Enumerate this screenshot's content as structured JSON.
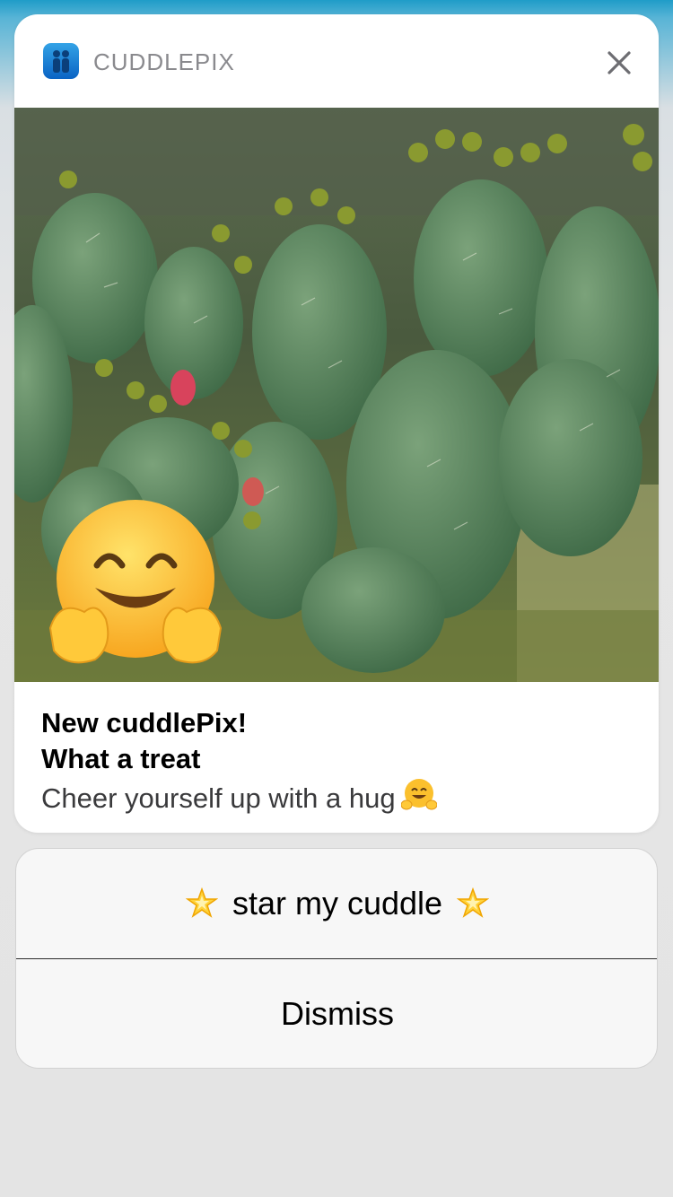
{
  "notification": {
    "app_name": "CUDDLEPIX",
    "app_icon": "cuddlepix-app-icon",
    "close_icon": "close-icon",
    "image": "cactus-photo-with-hug-emoji",
    "title_line_1": "New cuddlePix!",
    "title_line_2": "What a treat",
    "body": "Cheer yourself up with a hug",
    "body_emoji": "hugging-face-emoji"
  },
  "actions": [
    {
      "label": "star my cuddle",
      "icon": "glowing-star-icon"
    },
    {
      "label": "Dismiss"
    }
  ],
  "colors": {
    "app_icon": "#1a7fd8",
    "background_top": "#1f9cc8",
    "card": "#ffffff",
    "app_name": "#8a8a8e"
  }
}
